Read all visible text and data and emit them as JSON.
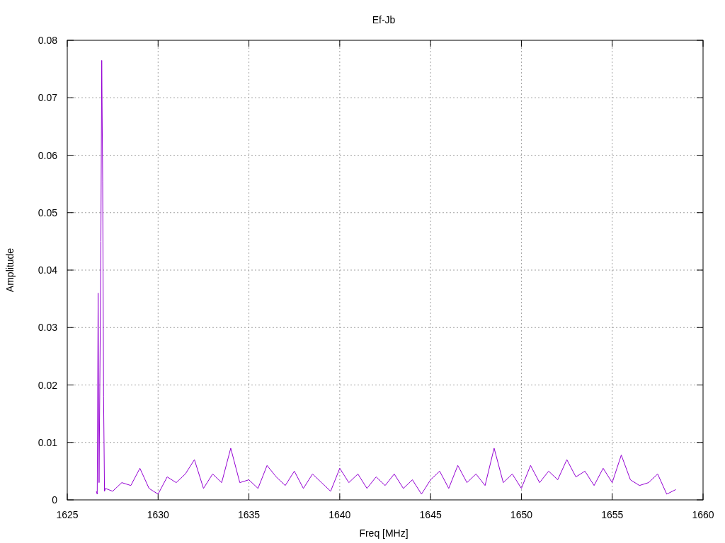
{
  "chart_data": {
    "type": "line",
    "grid": true,
    "title": "Ef-Jb",
    "xlabel": "Freq [MHz]",
    "ylabel": "Amplitude",
    "xlim": [
      1625,
      1660
    ],
    "ylim": [
      0,
      0.08
    ],
    "xticks": [
      1625,
      1630,
      1635,
      1640,
      1645,
      1650,
      1655,
      1660
    ],
    "yticks": [
      {
        "value": 0,
        "label": "0"
      },
      {
        "value": 0.01,
        "label": "0.01"
      },
      {
        "value": 0.02,
        "label": "0.02"
      },
      {
        "value": 0.03,
        "label": "0.03"
      },
      {
        "value": 0.04,
        "label": "0.04"
      },
      {
        "value": 0.05,
        "label": "0.05"
      },
      {
        "value": 0.06,
        "label": "0.06"
      },
      {
        "value": 0.07,
        "label": "0.07"
      },
      {
        "value": 0.08,
        "label": "0.08"
      }
    ],
    "x": [
      1626.6,
      1626.65,
      1626.7,
      1626.75,
      1626.8,
      1626.85,
      1626.9,
      1626.95,
      1627,
      1627.05,
      1627.1,
      1627.5,
      1628,
      1628.5,
      1629,
      1629.5,
      1630,
      1630.5,
      1631,
      1631.5,
      1632,
      1632.5,
      1633,
      1633.5,
      1634,
      1634.5,
      1635,
      1635.5,
      1636,
      1636.5,
      1637,
      1637.5,
      1638,
      1638.5,
      1639,
      1639.5,
      1640,
      1640.5,
      1641,
      1641.5,
      1642,
      1642.5,
      1643,
      1643.5,
      1644,
      1644.5,
      1645,
      1645.5,
      1646,
      1646.5,
      1647,
      1647.5,
      1648,
      1648.5,
      1649,
      1649.5,
      1650,
      1650.5,
      1651,
      1651.5,
      1652,
      1652.5,
      1653,
      1653.5,
      1654,
      1654.5,
      1655,
      1655.5,
      1656,
      1656.5,
      1657,
      1657.5,
      1658,
      1658.5
    ],
    "series": [
      {
        "color": "#9400d3",
        "values": [
          0.0015,
          0.001,
          0.036,
          0.003,
          0.023,
          0.045,
          0.0765,
          0.0555,
          0.018,
          0.0015,
          0.002,
          0.0015,
          0.003,
          0.0025,
          0.0055,
          0.002,
          0.001,
          0.004,
          0.003,
          0.0045,
          0.007,
          0.002,
          0.0045,
          0.003,
          0.009,
          0.003,
          0.0035,
          0.002,
          0.006,
          0.004,
          0.0025,
          0.005,
          0.002,
          0.0045,
          0.003,
          0.0015,
          0.0055,
          0.003,
          0.0045,
          0.002,
          0.004,
          0.0025,
          0.0045,
          0.002,
          0.0035,
          0.001,
          0.0035,
          0.005,
          0.002,
          0.006,
          0.003,
          0.0045,
          0.0025,
          0.009,
          0.003,
          0.0045,
          0.002,
          0.006,
          0.003,
          0.005,
          0.0035,
          0.007,
          0.004,
          0.005,
          0.0025,
          0.0055,
          0.003,
          0.0078,
          0.0035,
          0.0025,
          0.003,
          0.0045,
          0.001,
          0.0018
        ]
      }
    ]
  }
}
